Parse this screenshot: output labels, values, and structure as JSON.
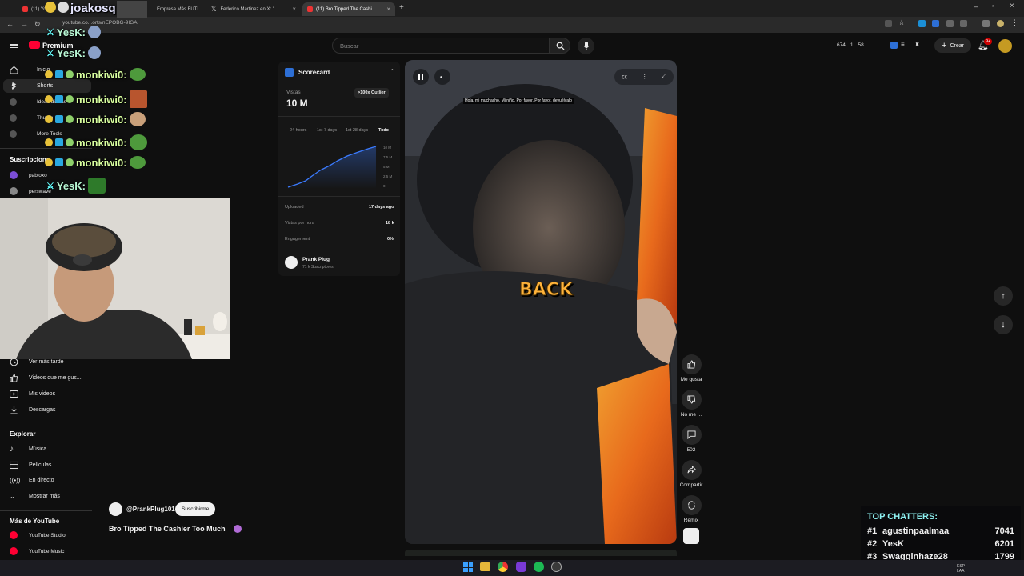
{
  "browser": {
    "tabs": [
      {
        "label": "(11) Yo",
        "active": false
      },
      {
        "label": "Empresa Más FUTI",
        "active": false
      },
      {
        "label": "Federico Martinez en X: \"",
        "active": false
      },
      {
        "label": "(11) Bro Tipped The Cashi",
        "active": true
      }
    ],
    "url": "youtube.co...orts/nEPOBG-9IGA"
  },
  "header": {
    "brand": "Premium",
    "search_placeholder": "Buscar",
    "stats": [
      "674",
      "1",
      "58"
    ],
    "create_label": "Crear",
    "notif_count": "9+"
  },
  "sidebar": {
    "top_items": [
      {
        "label": "Inicio",
        "icon": "home-icon"
      },
      {
        "label": "Shorts",
        "icon": "shorts-icon"
      },
      {
        "label": "Ideas diarias",
        "icon": "tool-icon"
      },
      {
        "label": "Thumb",
        "icon": "tool-icon"
      },
      {
        "label": "More Tools",
        "icon": "tool-icon"
      }
    ],
    "subs_title": "Suscripcione",
    "subs": [
      {
        "label": "pabloxo"
      },
      {
        "label": "perswave"
      }
    ],
    "you_items": [
      {
        "label": "Ver más tarde",
        "icon": "clock-icon"
      },
      {
        "label": "Videos que me gus...",
        "icon": "thumbs-up-icon"
      },
      {
        "label": "Mis videos",
        "icon": "play-icon"
      },
      {
        "label": "Descargas",
        "icon": "download-icon"
      }
    ],
    "explore_title": "Explorar",
    "explore_items": [
      {
        "label": "Música",
        "icon": "music-icon"
      },
      {
        "label": "Películas",
        "icon": "film-icon"
      },
      {
        "label": "En directo",
        "icon": "live-icon"
      },
      {
        "label": "Mostrar más",
        "icon": "chevron-down-icon"
      }
    ],
    "more_title": "Más de YouTube",
    "more_items": [
      {
        "label": "YouTube Studio"
      },
      {
        "label": "YouTube Music"
      }
    ]
  },
  "scorecard": {
    "title": "Scorecard",
    "views_label": "Vistas",
    "views_value": "10 M",
    "outlier_badge": ">100x Outlier",
    "ranges": [
      "24 hours",
      "1st 7 days",
      "1st 28 days",
      "Todo"
    ],
    "y_ticks": [
      "10 M",
      "7,5 M",
      "5 M",
      "2,5 M",
      "0"
    ],
    "rows": [
      {
        "label": "Uploaded",
        "value": "17 days ago"
      },
      {
        "label": "Vistas por hora",
        "value": "18 k"
      },
      {
        "label": "Engagement",
        "value": "0%"
      }
    ],
    "channel_name": "Prank Plug",
    "channel_subs": "71 k Suscriptores"
  },
  "video": {
    "subtitle_top": "Hola, mi muchacho.  Mi niño.  Por favor.  Por favor, devuélvalo",
    "caption_word": "BACK",
    "channel_handle": "@PrankPlug101",
    "subscribe_label": "Suscribirme",
    "title": "Bro Tipped The Cashier Too Much"
  },
  "actions": [
    {
      "label": "Me gusta",
      "icon": "thumbs-up-icon"
    },
    {
      "label": "No me ...",
      "icon": "thumbs-down-icon"
    },
    {
      "label": "502",
      "icon": "comment-icon"
    },
    {
      "label": "Compartir",
      "icon": "share-icon"
    },
    {
      "label": "Remix",
      "icon": "remix-icon"
    }
  ],
  "stream_overlay": {
    "streamer_name": "joakosq:",
    "chat_lines": [
      {
        "user": "YesK:",
        "color": "#b8f7d4"
      },
      {
        "user": "YesK:",
        "color": "#b8f7d4"
      },
      {
        "user": "monkiwi0:",
        "color": "#d9ff9f"
      },
      {
        "user": "monkiwi0:",
        "color": "#d9ff9f"
      },
      {
        "user": "monkiwi0:",
        "color": "#d9ff9f"
      },
      {
        "user": "monkiwi0:",
        "color": "#d9ff9f"
      },
      {
        "user": "monkiwi0:",
        "color": "#d9ff9f"
      },
      {
        "user": "YesK:",
        "color": "#b8f7d4"
      }
    ],
    "top_chatters_title": "TOP CHATTERS:",
    "top_chatters": [
      {
        "rank": "#1",
        "name": "agustinpaalmaa",
        "count": "7041"
      },
      {
        "rank": "#2",
        "name": "YesK",
        "count": "6201"
      },
      {
        "rank": "#3",
        "name": "Swagginhaze28",
        "count": "1799"
      }
    ]
  },
  "taskbar": {
    "lang": "ESP LAA"
  },
  "colors": {
    "accent_red": "#ff0033",
    "chart_blue": "#3b7bff",
    "overlay_green": "#d9ff9f"
  }
}
